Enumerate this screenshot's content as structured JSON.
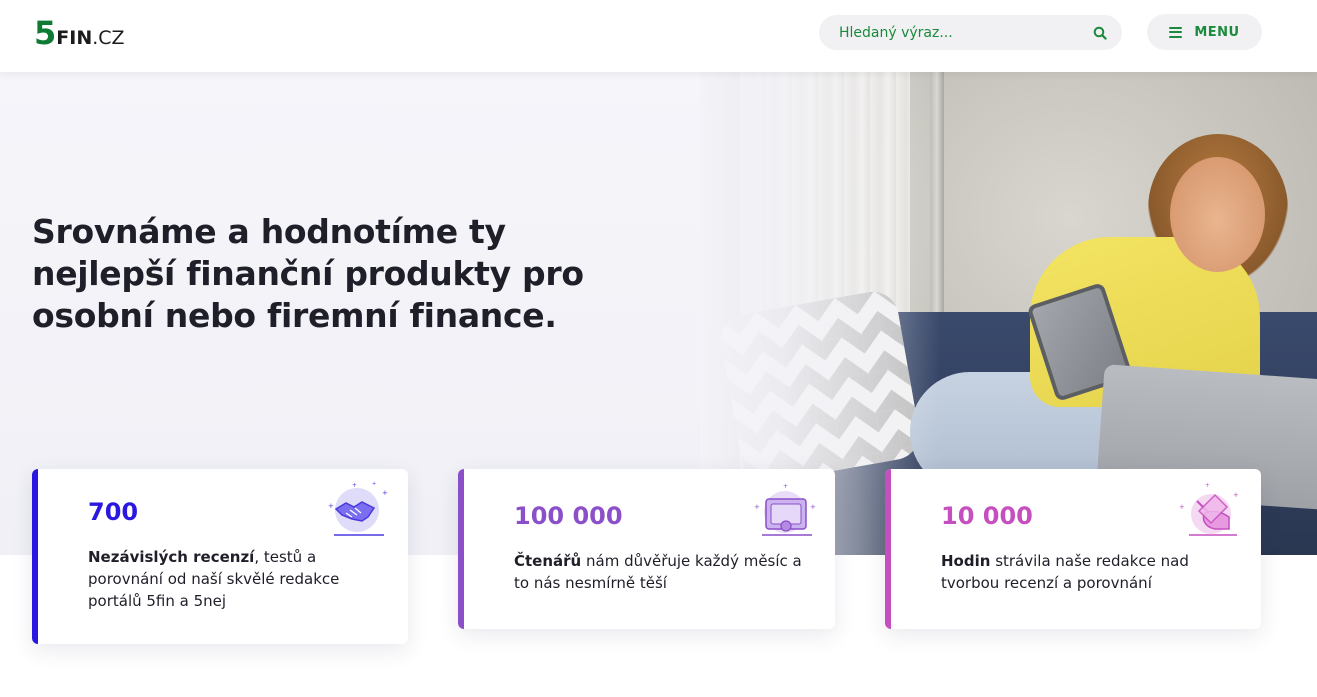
{
  "header": {
    "logo": {
      "digit": "5",
      "text": "FIN",
      "tld": ".CZ"
    },
    "search": {
      "placeholder": "Hledaný výraz...",
      "icon": "search-icon"
    },
    "menu": {
      "label": "MENU",
      "icon": "hamburger-icon"
    }
  },
  "hero": {
    "title": "Srovnáme a hodnotíme ty nejlepší finanční produkty pro osobní nebo firemní finance.",
    "image": "woman-on-sofa-with-tablet-photo"
  },
  "stats": [
    {
      "value": "700",
      "bold": "Nezávislých recenzí",
      "text": ", testů a porovnání od naší skvělé redakce portálů 5fin a 5nej",
      "icon": "handshake-icon",
      "color": "#2a17e0"
    },
    {
      "value": "100 000",
      "bold": "Čtenářů",
      "text": " nám důvěřuje každý měsíc a to nás nesmírně těší",
      "icon": "certificate-icon",
      "color": "#8b4fc9"
    },
    {
      "value": "10 000",
      "bold": "Hodin",
      "text": " strávila naše redakce nad tvorbou recenzí a porovnání",
      "icon": "writing-hand-icon",
      "color": "#c64fbf"
    }
  ],
  "colors": {
    "brand_green": "#0f7a34",
    "accent_green": "#1a8a3c",
    "hero_bg": "#f3f3f8"
  }
}
